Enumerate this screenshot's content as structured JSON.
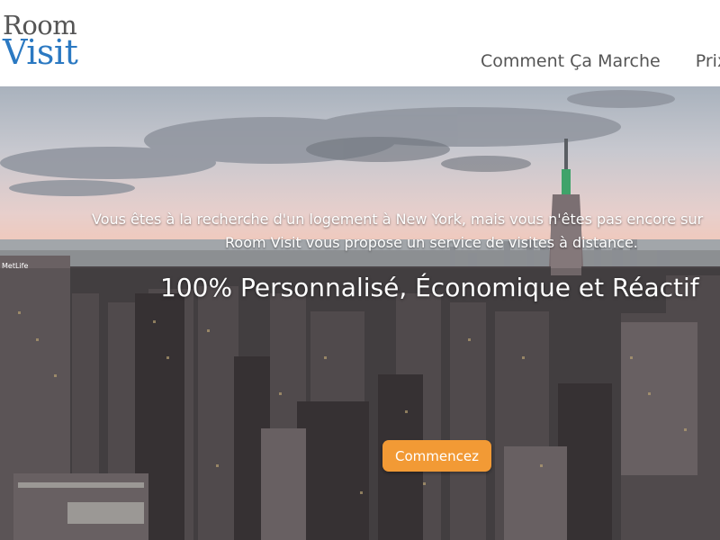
{
  "logo": {
    "line1": "Room",
    "line2": "Visit"
  },
  "nav": {
    "items": [
      "Comment Ça Marche",
      "Prix"
    ]
  },
  "hero": {
    "tagline_line1": "Vous êtes à la recherche d'un logement à New York, mais vous n'êtes pas encore sur",
    "tagline_line2": "Room Visit vous propose un service de visites à distance.",
    "headline": "100% Personnalisé, Économique et Réactif",
    "cta_label": "Commencez",
    "building_sign": "MetLife"
  },
  "colors": {
    "logo_blue": "#2b79c2",
    "cta_orange": "#f29a35",
    "nav_text": "#555555"
  }
}
